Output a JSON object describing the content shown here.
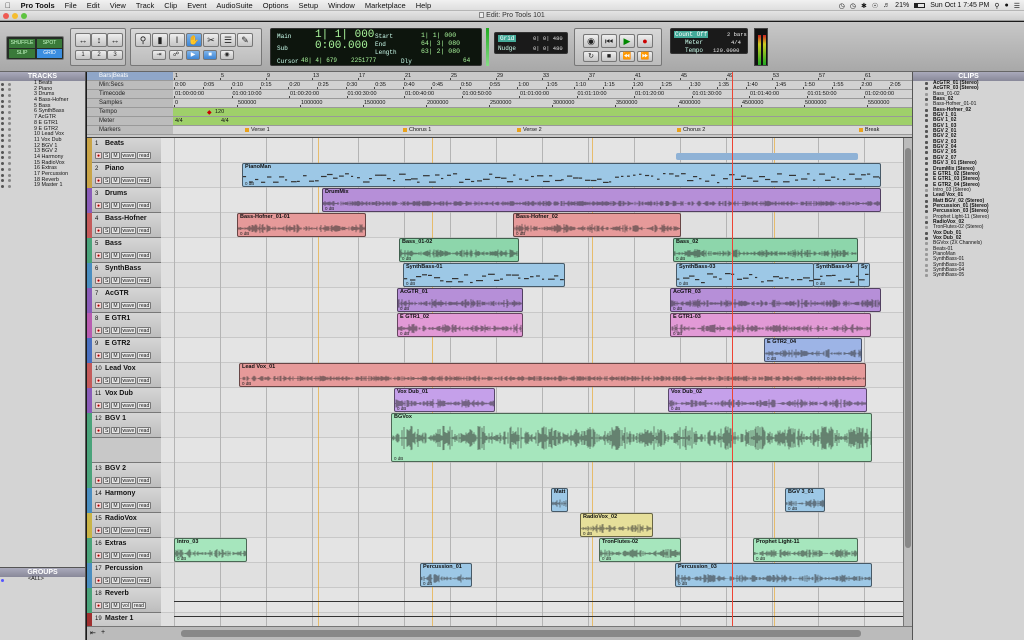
{
  "menubar": {
    "apple": "",
    "app": "Pro Tools",
    "items": [
      "File",
      "Edit",
      "View",
      "Track",
      "Clip",
      "Event",
      "AudioSuite",
      "Options",
      "Setup",
      "Window",
      "Marketplace",
      "Help"
    ],
    "battery": "21%",
    "clock": "Sun Oct 1  7:45 PM"
  },
  "window": {
    "title": "Edit: Pro Tools 101"
  },
  "toolbar": {
    "modes": {
      "shuffle": "SHUFFLE",
      "spot": "SPOT",
      "slip": "SLIP",
      "grid": "GRID"
    },
    "counters": {
      "main_label": "Main",
      "main_value": "1| 1| 000",
      "sub_label": "Sub",
      "sub_value": "0:00.000",
      "cursor_label": "Cursor",
      "cursor_value": "48| 4| 679",
      "cursor_samples": "2251777",
      "dly": "Dly",
      "dly_value": "64"
    },
    "selection": {
      "start_label": "Start",
      "start_value": "1| 1| 000",
      "end_label": "End",
      "end_value": "64| 3| 080",
      "length_label": "Length",
      "length_value": "63| 2| 080"
    },
    "grid": {
      "grid_label": "Grid",
      "grid_value": "0| 0| 480",
      "nudge_label": "Nudge",
      "nudge_value": "0| 0| 480"
    },
    "meter": {
      "countoff_label": "Count Off",
      "countoff_value": "2 bars",
      "meter_label": "Meter",
      "meter_value": "4/4",
      "tempo_label": "Tempo",
      "tempo_value": "120.0000"
    }
  },
  "tracks_pane": {
    "title": "TRACKS",
    "items": [
      "1 Beats",
      "2 Piano",
      "3 Drums",
      "4 Bass-Hofner",
      "5 Bass",
      "6 SynthBass",
      "7 AcGTR",
      "8 E GTR1",
      "9 E GTR2",
      "10 Lead Vox",
      "11 Vox Dub",
      "12 BGV 1",
      "13 BGV 2",
      "14 Harmony",
      "15 RadioVox",
      "16 Extras",
      "17 Percussion",
      "18 Reverb",
      "19 Master 1"
    ]
  },
  "groups_pane": {
    "title": "GROUPS",
    "items": [
      "<ALL>"
    ]
  },
  "rulers": {
    "labels": [
      "Bars|Beats",
      "Min:Secs",
      "Timecode",
      "Samples",
      "Tempo",
      "Meter",
      "Markers"
    ],
    "bars": [
      "1",
      "5",
      "9",
      "13",
      "17",
      "21",
      "25",
      "29",
      "33",
      "37",
      "41",
      "45",
      "49",
      "53",
      "57",
      "61"
    ],
    "minsecs": [
      "0:00",
      "0:05",
      "0:10",
      "0:15",
      "0:20",
      "0:25",
      "0:30",
      "0:35",
      "0:40",
      "0:45",
      "0:50",
      "0:55",
      "1:00",
      "1:05",
      "1:10",
      "1:15",
      "1:20",
      "1:25",
      "1:30",
      "1:35",
      "1:40",
      "1:45",
      "1:50",
      "1:55",
      "2:00",
      "2:05"
    ],
    "timecode": [
      "01:00:00:00",
      "01:00:10:00",
      "01:00:20:00",
      "01:00:30:00",
      "01:00:40:00",
      "01:00:50:00",
      "01:01:00:00",
      "01:01:10:00",
      "01:01:20:00",
      "01:01:30:00",
      "01:01:40:00",
      "01:01:50:00",
      "01:02:00:00"
    ],
    "samples": [
      "0",
      "500000",
      "1000000",
      "1500000",
      "2000000",
      "2500000",
      "3000000",
      "3500000",
      "4000000",
      "4500000",
      "5000000",
      "5500000"
    ],
    "tempo": "120",
    "meter": "4/4",
    "markers": [
      "Verse 1",
      "Chorus 1",
      "Verse 2",
      "Chorus 2",
      "Break"
    ]
  },
  "tracks": [
    {
      "num": "1",
      "name": "Beats",
      "color": "#c9a447"
    },
    {
      "num": "2",
      "name": "Piano",
      "color": "#c9a447"
    },
    {
      "num": "3",
      "name": "Drums",
      "color": "#8a5cb8"
    },
    {
      "num": "4",
      "name": "Bass-Hofner",
      "color": "#c45a5a"
    },
    {
      "num": "5",
      "name": "Bass",
      "color": "#4aa37a"
    },
    {
      "num": "6",
      "name": "SynthBass",
      "color": "#4a8ec0"
    },
    {
      "num": "7",
      "name": "AcGTR",
      "color": "#8a5cb8"
    },
    {
      "num": "8",
      "name": "E GTR1",
      "color": "#b85cb0"
    },
    {
      "num": "9",
      "name": "E GTR2",
      "color": "#4a70c0"
    },
    {
      "num": "10",
      "name": "Lead Vox",
      "color": "#c45a5a"
    },
    {
      "num": "11",
      "name": "Vox Dub",
      "color": "#8a5cb8"
    },
    {
      "num": "12",
      "name": "BGV 1",
      "color": "#4aa37a"
    },
    {
      "num": "13",
      "name": "BGV 2",
      "color": "#4aa37a"
    },
    {
      "num": "14",
      "name": "Harmony",
      "color": "#4a8ec0"
    },
    {
      "num": "15",
      "name": "RadioVox",
      "color": "#c9b447"
    },
    {
      "num": "16",
      "name": "Extras",
      "color": "#4aa37a"
    },
    {
      "num": "17",
      "name": "Percussion",
      "color": "#4a8ec0"
    },
    {
      "num": "18",
      "name": "Reverb",
      "color": "#4aa37a"
    },
    {
      "num": "19",
      "name": "Master 1",
      "color": "#a03030"
    }
  ],
  "track_controls": {
    "solo": "S",
    "mute": "M",
    "rec": "●",
    "wave": "wave",
    "read": "read",
    "vol": "vol",
    "volume": "volume"
  },
  "clips": [
    {
      "track": 1,
      "name": "PianoMan",
      "color": "#9dc8e6"
    },
    {
      "track": 2,
      "name": "DrumMix",
      "color": "#b68fd8"
    },
    {
      "track": 3,
      "name": "Bass-Hofner_01-01",
      "color": "#e69a9a"
    },
    {
      "track": 3,
      "name": "Bass-Hofner_02",
      "color": "#e69a9a"
    },
    {
      "track": 4,
      "name": "Bass_01-02",
      "color": "#8dd6ab"
    },
    {
      "track": 4,
      "name": "Bass_02",
      "color": "#8dd6ab"
    },
    {
      "track": 5,
      "name": "SynthBass-01",
      "color": "#9dc8e6"
    },
    {
      "track": 5,
      "name": "SynthBass-03",
      "color": "#9dc8e6"
    },
    {
      "track": 5,
      "name": "SynthBass-04",
      "color": "#9dc8e6"
    },
    {
      "track": 5,
      "name": "Sy",
      "color": "#9dc8e6"
    },
    {
      "track": 6,
      "name": "AcGTR_01",
      "color": "#b68fd8"
    },
    {
      "track": 6,
      "name": "AcGTR_03",
      "color": "#b68fd8"
    },
    {
      "track": 7,
      "name": "E GTR1_02",
      "color": "#e29ad6"
    },
    {
      "track": 7,
      "name": "E GTR1-03",
      "color": "#e29ad6"
    },
    {
      "track": 8,
      "name": "E GTR2_04",
      "color": "#9db4e6"
    },
    {
      "track": 9,
      "name": "Lead Vox_01",
      "color": "#e69a9a"
    },
    {
      "track": 10,
      "name": "Vox Dub_01",
      "color": "#c5a0ea"
    },
    {
      "track": 10,
      "name": "Vox Dub_02",
      "color": "#c5a0ea"
    },
    {
      "track": 11,
      "name": "BGVox",
      "color": "#a6e6bd"
    },
    {
      "track": 13,
      "name": "Matt 1",
      "color": "#9dc8e6"
    },
    {
      "track": 13,
      "name": "BGV 3_01",
      "color": "#9dc8e6"
    },
    {
      "track": 14,
      "name": "RadioVox_02",
      "color": "#e6df9a"
    },
    {
      "track": 15,
      "name": "Intro_03",
      "color": "#a6e6bd"
    },
    {
      "track": 15,
      "name": "TronFlutes-02",
      "color": "#a6e6bd"
    },
    {
      "track": 15,
      "name": "Prophet Light-11",
      "color": "#a6e6bd"
    },
    {
      "track": 16,
      "name": "Percussion_01",
      "color": "#9dc8e6"
    },
    {
      "track": 16,
      "name": "Percussion_03",
      "color": "#9dc8e6"
    }
  ],
  "clip_db": "0 dB",
  "clips_pane": {
    "title": "CLIPS",
    "items": [
      {
        "t": "AcGTR_01 (Stereo)",
        "b": true
      },
      {
        "t": "AcGTR_03 (Stereo)",
        "b": true
      },
      {
        "t": "Bass_01-02",
        "b": false
      },
      {
        "t": "Bass_02",
        "b": true
      },
      {
        "t": "Bass-Hofner_01-01",
        "b": false
      },
      {
        "t": "Bass-Hofner_02",
        "b": true
      },
      {
        "t": "BGV 1_01",
        "b": true
      },
      {
        "t": "BGV 1_02",
        "b": true
      },
      {
        "t": "BGV 1_03",
        "b": true
      },
      {
        "t": "BGV 2_01",
        "b": true
      },
      {
        "t": "BGV 2_02",
        "b": true
      },
      {
        "t": "BGV 2_03",
        "b": true
      },
      {
        "t": "BGV 2_04",
        "b": true
      },
      {
        "t": "BGV 2_05",
        "b": true
      },
      {
        "t": "BGV 2_07",
        "b": true
      },
      {
        "t": "BGV 3_01 (Stereo)",
        "b": true
      },
      {
        "t": "DrumMix (Stereo)",
        "b": true
      },
      {
        "t": "E GTR1_02 (Stereo)",
        "b": true
      },
      {
        "t": "E GTR1_03 (Stereo)",
        "b": true
      },
      {
        "t": "E GTR2_04 (Stereo)",
        "b": true
      },
      {
        "t": "Intro_03 (Stereo)",
        "b": false
      },
      {
        "t": "Lead Vox_01",
        "b": true
      },
      {
        "t": "Matt BGV_02 (Stereo)",
        "b": true
      },
      {
        "t": "Percussion_01 (Stereo)",
        "b": true
      },
      {
        "t": "Percussion_03 (Stereo)",
        "b": true
      },
      {
        "t": "Prophet Light-11 (Stereo)",
        "b": false
      },
      {
        "t": "RadioVox_02",
        "b": true
      },
      {
        "t": "TronFlutes-02 (Stereo)",
        "b": false
      },
      {
        "t": "Vox Dub_01",
        "b": true
      },
      {
        "t": "Vox Dub_02",
        "b": true
      },
      {
        "t": "BGVox (2X Channels)",
        "b": false
      },
      {
        "t": "Beats-01",
        "b": false
      },
      {
        "t": "PianoMan",
        "b": false
      },
      {
        "t": "SynthBass-01",
        "b": false
      },
      {
        "t": "SynthBass-03",
        "b": false
      },
      {
        "t": "SynthBass-04",
        "b": false
      },
      {
        "t": "SynthBass-05",
        "b": false
      }
    ]
  }
}
